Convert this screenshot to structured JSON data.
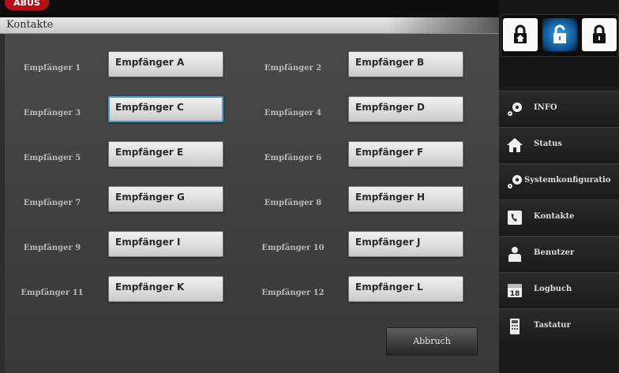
{
  "brand": {
    "logo_text": "ABUS"
  },
  "window": {
    "title": "Kontakte"
  },
  "contacts": [
    {
      "label": "Empfänger 1",
      "value": "Empfänger A"
    },
    {
      "label": "Empfänger 2",
      "value": "Empfänger B"
    },
    {
      "label": "Empfänger 3",
      "value": "Empfänger C"
    },
    {
      "label": "Empfänger 4",
      "value": "Empfänger D"
    },
    {
      "label": "Empfänger 5",
      "value": "Empfänger E"
    },
    {
      "label": "Empfänger 6",
      "value": "Empfänger F"
    },
    {
      "label": "Empfänger 7",
      "value": "Empfänger G"
    },
    {
      "label": "Empfänger 8",
      "value": "Empfänger H"
    },
    {
      "label": "Empfänger 9",
      "value": "Empfänger I"
    },
    {
      "label": "Empfänger 10",
      "value": "Empfänger J"
    },
    {
      "label": "Empfänger 11",
      "value": "Empfänger K"
    },
    {
      "label": "Empfänger 12",
      "value": "Empfänger L"
    }
  ],
  "actions": {
    "cancel": "Abbruch"
  },
  "lock_modes": [
    {
      "icon": "home-lock-icon",
      "state": "inactive"
    },
    {
      "icon": "open-lock-icon",
      "state": "active"
    },
    {
      "icon": "closed-lock-icon",
      "state": "inactive"
    }
  ],
  "sidebar": {
    "items": [
      {
        "label": "INFO",
        "icon": "gear-icon"
      },
      {
        "label": "Status",
        "icon": "house-icon"
      },
      {
        "label": "Systemkonfiguratio",
        "icon": "gear-icon"
      },
      {
        "label": "Kontakte",
        "icon": "phone-book-icon"
      },
      {
        "label": "Benutzer",
        "icon": "user-icon"
      },
      {
        "label": "Logbuch",
        "icon": "calendar-icon"
      },
      {
        "label": "Tastatur",
        "icon": "keypad-icon"
      }
    ]
  },
  "colors": {
    "accent": "#4a9fd8",
    "brand": "#b3121b",
    "active_lock": "#1f86cf"
  }
}
